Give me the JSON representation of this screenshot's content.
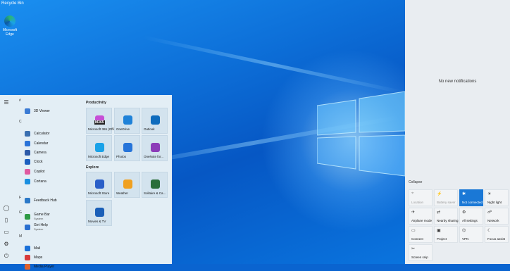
{
  "desktop": {
    "top_label": "Recycle Bin",
    "edge_label_line1": "Microsoft",
    "edge_label_line2": "Edge"
  },
  "start": {
    "letters": [
      "#",
      "C",
      "F",
      "G",
      "M"
    ],
    "apps": [
      {
        "name": "3D Viewer",
        "color": "#3b7bd4"
      },
      {
        "name": "Calculator",
        "color": "#3a6fb0"
      },
      {
        "name": "Calendar",
        "color": "#2a73d8"
      },
      {
        "name": "Camera",
        "color": "#2d5aa8"
      },
      {
        "name": "Clock",
        "color": "#1b5fbf"
      },
      {
        "name": "Copilot",
        "color": "#e05aa0"
      },
      {
        "name": "Cortana",
        "color": "#1a8fe0"
      },
      {
        "name": "Feedback Hub",
        "color": "#2a78c8"
      },
      {
        "name": "Game Bar",
        "sub": "System",
        "color": "#2d9a45"
      },
      {
        "name": "Get Help",
        "sub": "System",
        "color": "#2a6fd0"
      },
      {
        "name": "Mail",
        "color": "#1a70d8"
      },
      {
        "name": "Maps",
        "color": "#d83a3a"
      },
      {
        "name": "Media Player",
        "color": "#e0602a"
      }
    ],
    "groups": {
      "productivity": "Productivity",
      "explore": "Explore"
    },
    "tiles": [
      {
        "label": "Microsoft 365 (Office)",
        "badge": "M365",
        "color": "#c64fd6"
      },
      {
        "label": "OneDrive",
        "color": "#1f82d8"
      },
      {
        "label": "Outlook",
        "color": "#0f6cbd"
      },
      {
        "label": "Microsoft Edge",
        "color": "#1aa2e8"
      },
      {
        "label": "Photos",
        "color": "#2674d9"
      },
      {
        "label": "OneNote for...",
        "color": "#8c3cb8"
      },
      {
        "label": "Microsoft Store",
        "color": "#2a5fc8"
      },
      {
        "label": "Weather",
        "color": "#f0a020"
      },
      {
        "label": "Solitaire & Ca...",
        "color": "#2a6e3a"
      },
      {
        "label": "Movies & TV",
        "color": "#1a5fb8"
      }
    ]
  },
  "action_center": {
    "no_notifications": "No new notifications",
    "collapse": "Collapse",
    "tiles": [
      {
        "label": "Location",
        "icon": "⌖",
        "state": "dim"
      },
      {
        "label": "Battery saver",
        "icon": "⚡",
        "state": "dim"
      },
      {
        "label": "Not connected",
        "icon": "✱",
        "state": "on"
      },
      {
        "label": "Night light",
        "icon": "☀",
        "state": "off"
      },
      {
        "label": "Airplane mode",
        "icon": "✈",
        "state": "off"
      },
      {
        "label": "Nearby sharing",
        "icon": "⇄",
        "state": "off"
      },
      {
        "label": "All settings",
        "icon": "⚙",
        "state": "off"
      },
      {
        "label": "Network",
        "icon": "☍",
        "state": "off"
      },
      {
        "label": "Connect",
        "icon": "▭",
        "state": "off"
      },
      {
        "label": "Project",
        "icon": "▣",
        "state": "off"
      },
      {
        "label": "VPN",
        "icon": "⌬",
        "state": "off"
      },
      {
        "label": "Focus assist",
        "icon": "☾",
        "state": "off"
      },
      {
        "label": "Screen snip",
        "icon": "✂",
        "state": "off"
      }
    ]
  }
}
